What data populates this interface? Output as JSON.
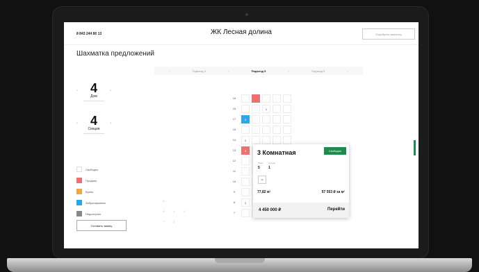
{
  "header": {
    "phone": "8 843 244 80 13",
    "title": "ЖК Лесная долина",
    "pick_button": "Подобрать квартиру"
  },
  "page": {
    "heading": "Шахматка предложений",
    "entrances": [
      "Подъезд 4",
      "Подъезд 5",
      "Подъезд 6"
    ],
    "active_entrance": "Подъезд 5"
  },
  "house": {
    "value": "4",
    "label": "Дом"
  },
  "section": {
    "value": "4",
    "label": "Секция"
  },
  "legend": [
    {
      "label": "Свободно",
      "color": "#ffffff"
    },
    {
      "label": "Продано",
      "color": "#f07070"
    },
    {
      "label": "Бронь",
      "color": "#f2a640"
    },
    {
      "label": "Забронировано",
      "color": "#2aa7e8"
    },
    {
      "label": "Недоступно",
      "color": "#888888"
    }
  ],
  "apply_button": "Оставить заявку",
  "floors": [
    "16",
    "15",
    "17",
    "15",
    "14",
    "13",
    "12",
    "11",
    "10",
    "9",
    "8",
    "7"
  ],
  "flat_marks": {
    "floor15_col3": "1",
    "floor17_col1": "3",
    "floor14_col1": "1",
    "floor13_col1": "3",
    "floor11_col2": "3k",
    "floor8_col1": "1",
    "floor7_col2": "3",
    "floor7_col6": "3"
  },
  "card": {
    "title": "3 Комнатная",
    "status": "Свободно",
    "floor_label": "Этаж",
    "floor_value": "5",
    "section_label": "Секция",
    "section_value": "1",
    "rooms_badge": "3k",
    "area": "77,82 м²",
    "price_per_m2": "57 553 ₽ за м²",
    "price": "4 450 000 ₽",
    "go": "Перейти"
  }
}
